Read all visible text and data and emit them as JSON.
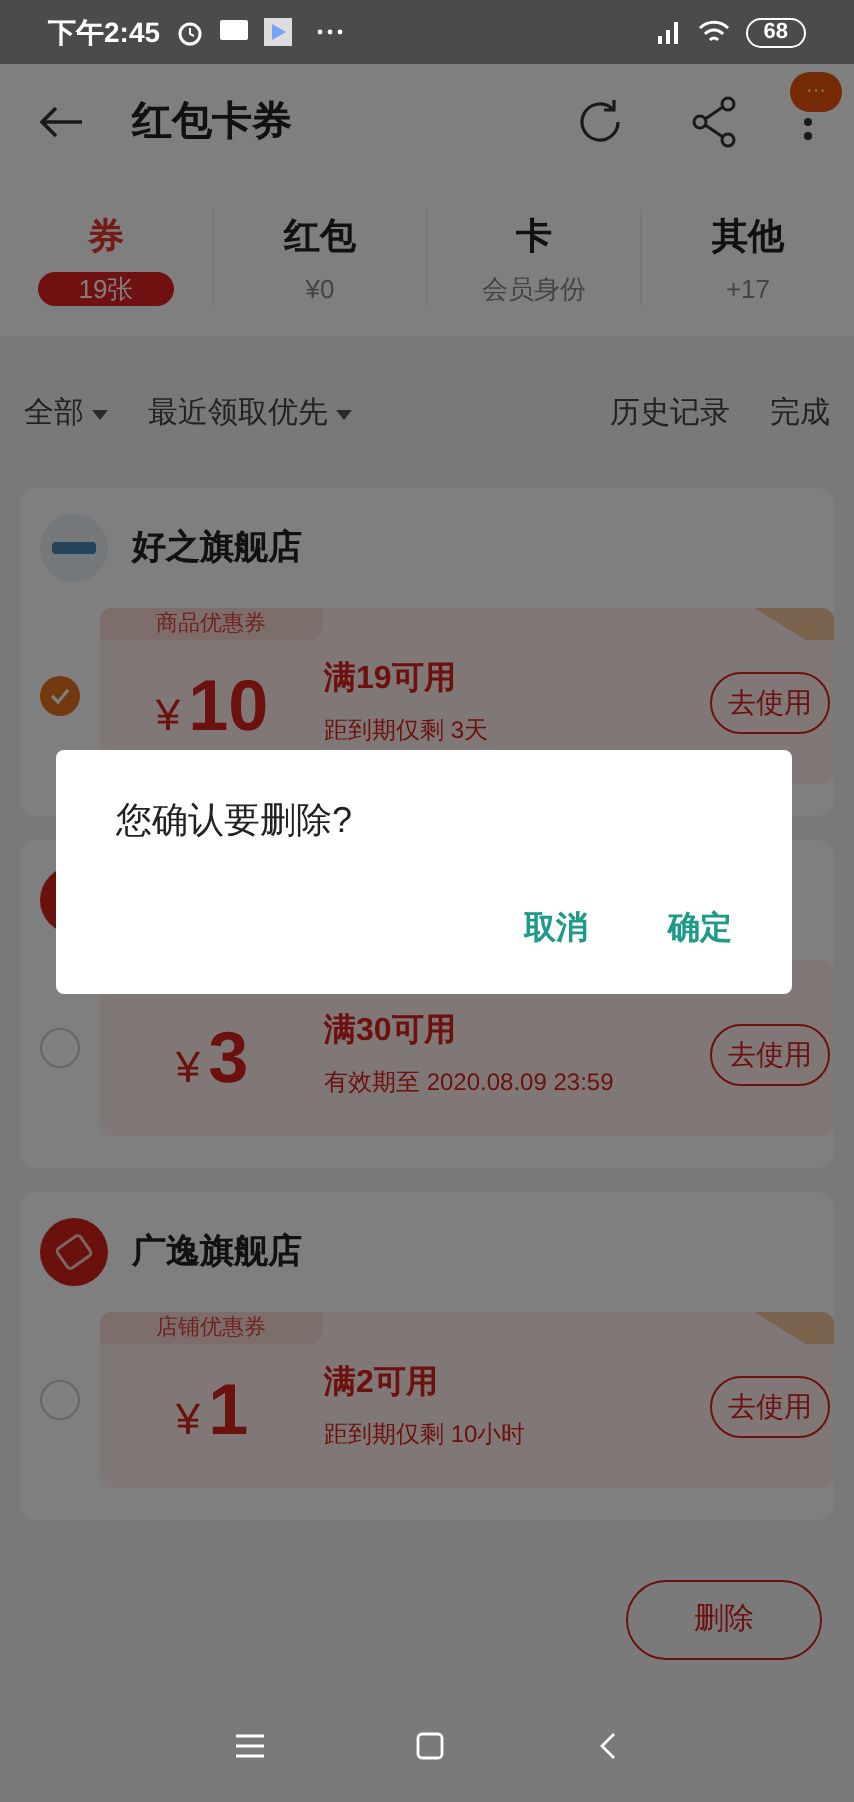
{
  "status_bar": {
    "time": "下午2:45",
    "battery": "68"
  },
  "header": {
    "title": "红包卡券",
    "badge": "···"
  },
  "tabs": [
    {
      "label": "券",
      "sub": "19张",
      "selected": true
    },
    {
      "label": "红包",
      "sub": "¥0",
      "selected": false
    },
    {
      "label": "卡",
      "sub": "会员身份",
      "selected": false
    },
    {
      "label": "其他",
      "sub": "+17",
      "selected": false
    }
  ],
  "filters": {
    "dropdowns": [
      "全部",
      "最近领取优先"
    ],
    "links": [
      "历史记录",
      "完成"
    ]
  },
  "stores": [
    {
      "name": "好之旗舰店",
      "kind": "brand",
      "coupons": [
        {
          "type_label": "商品优惠券",
          "currency": "¥",
          "amount": "10",
          "condition": "满19可用",
          "validity": "距到期仅剩 3天",
          "button": "去使用",
          "checked": true
        }
      ]
    },
    {
      "kind": "ticket",
      "coupons": [
        {
          "currency": "¥",
          "amount": "3",
          "condition": "满30可用",
          "validity": "有效期至 2020.08.09 23:59",
          "button": "去使用",
          "checked": false
        }
      ]
    },
    {
      "name": "广逸旗舰店",
      "kind": "ticket",
      "coupons": [
        {
          "type_label": "店铺优惠券",
          "currency": "¥",
          "amount": "1",
          "condition": "满2可用",
          "validity": "距到期仅剩 10小时",
          "button": "去使用",
          "checked": false
        }
      ]
    }
  ],
  "delete_button": "删除",
  "dialog": {
    "message": "您确认要删除?",
    "buttons": [
      "取消",
      "确定"
    ]
  }
}
